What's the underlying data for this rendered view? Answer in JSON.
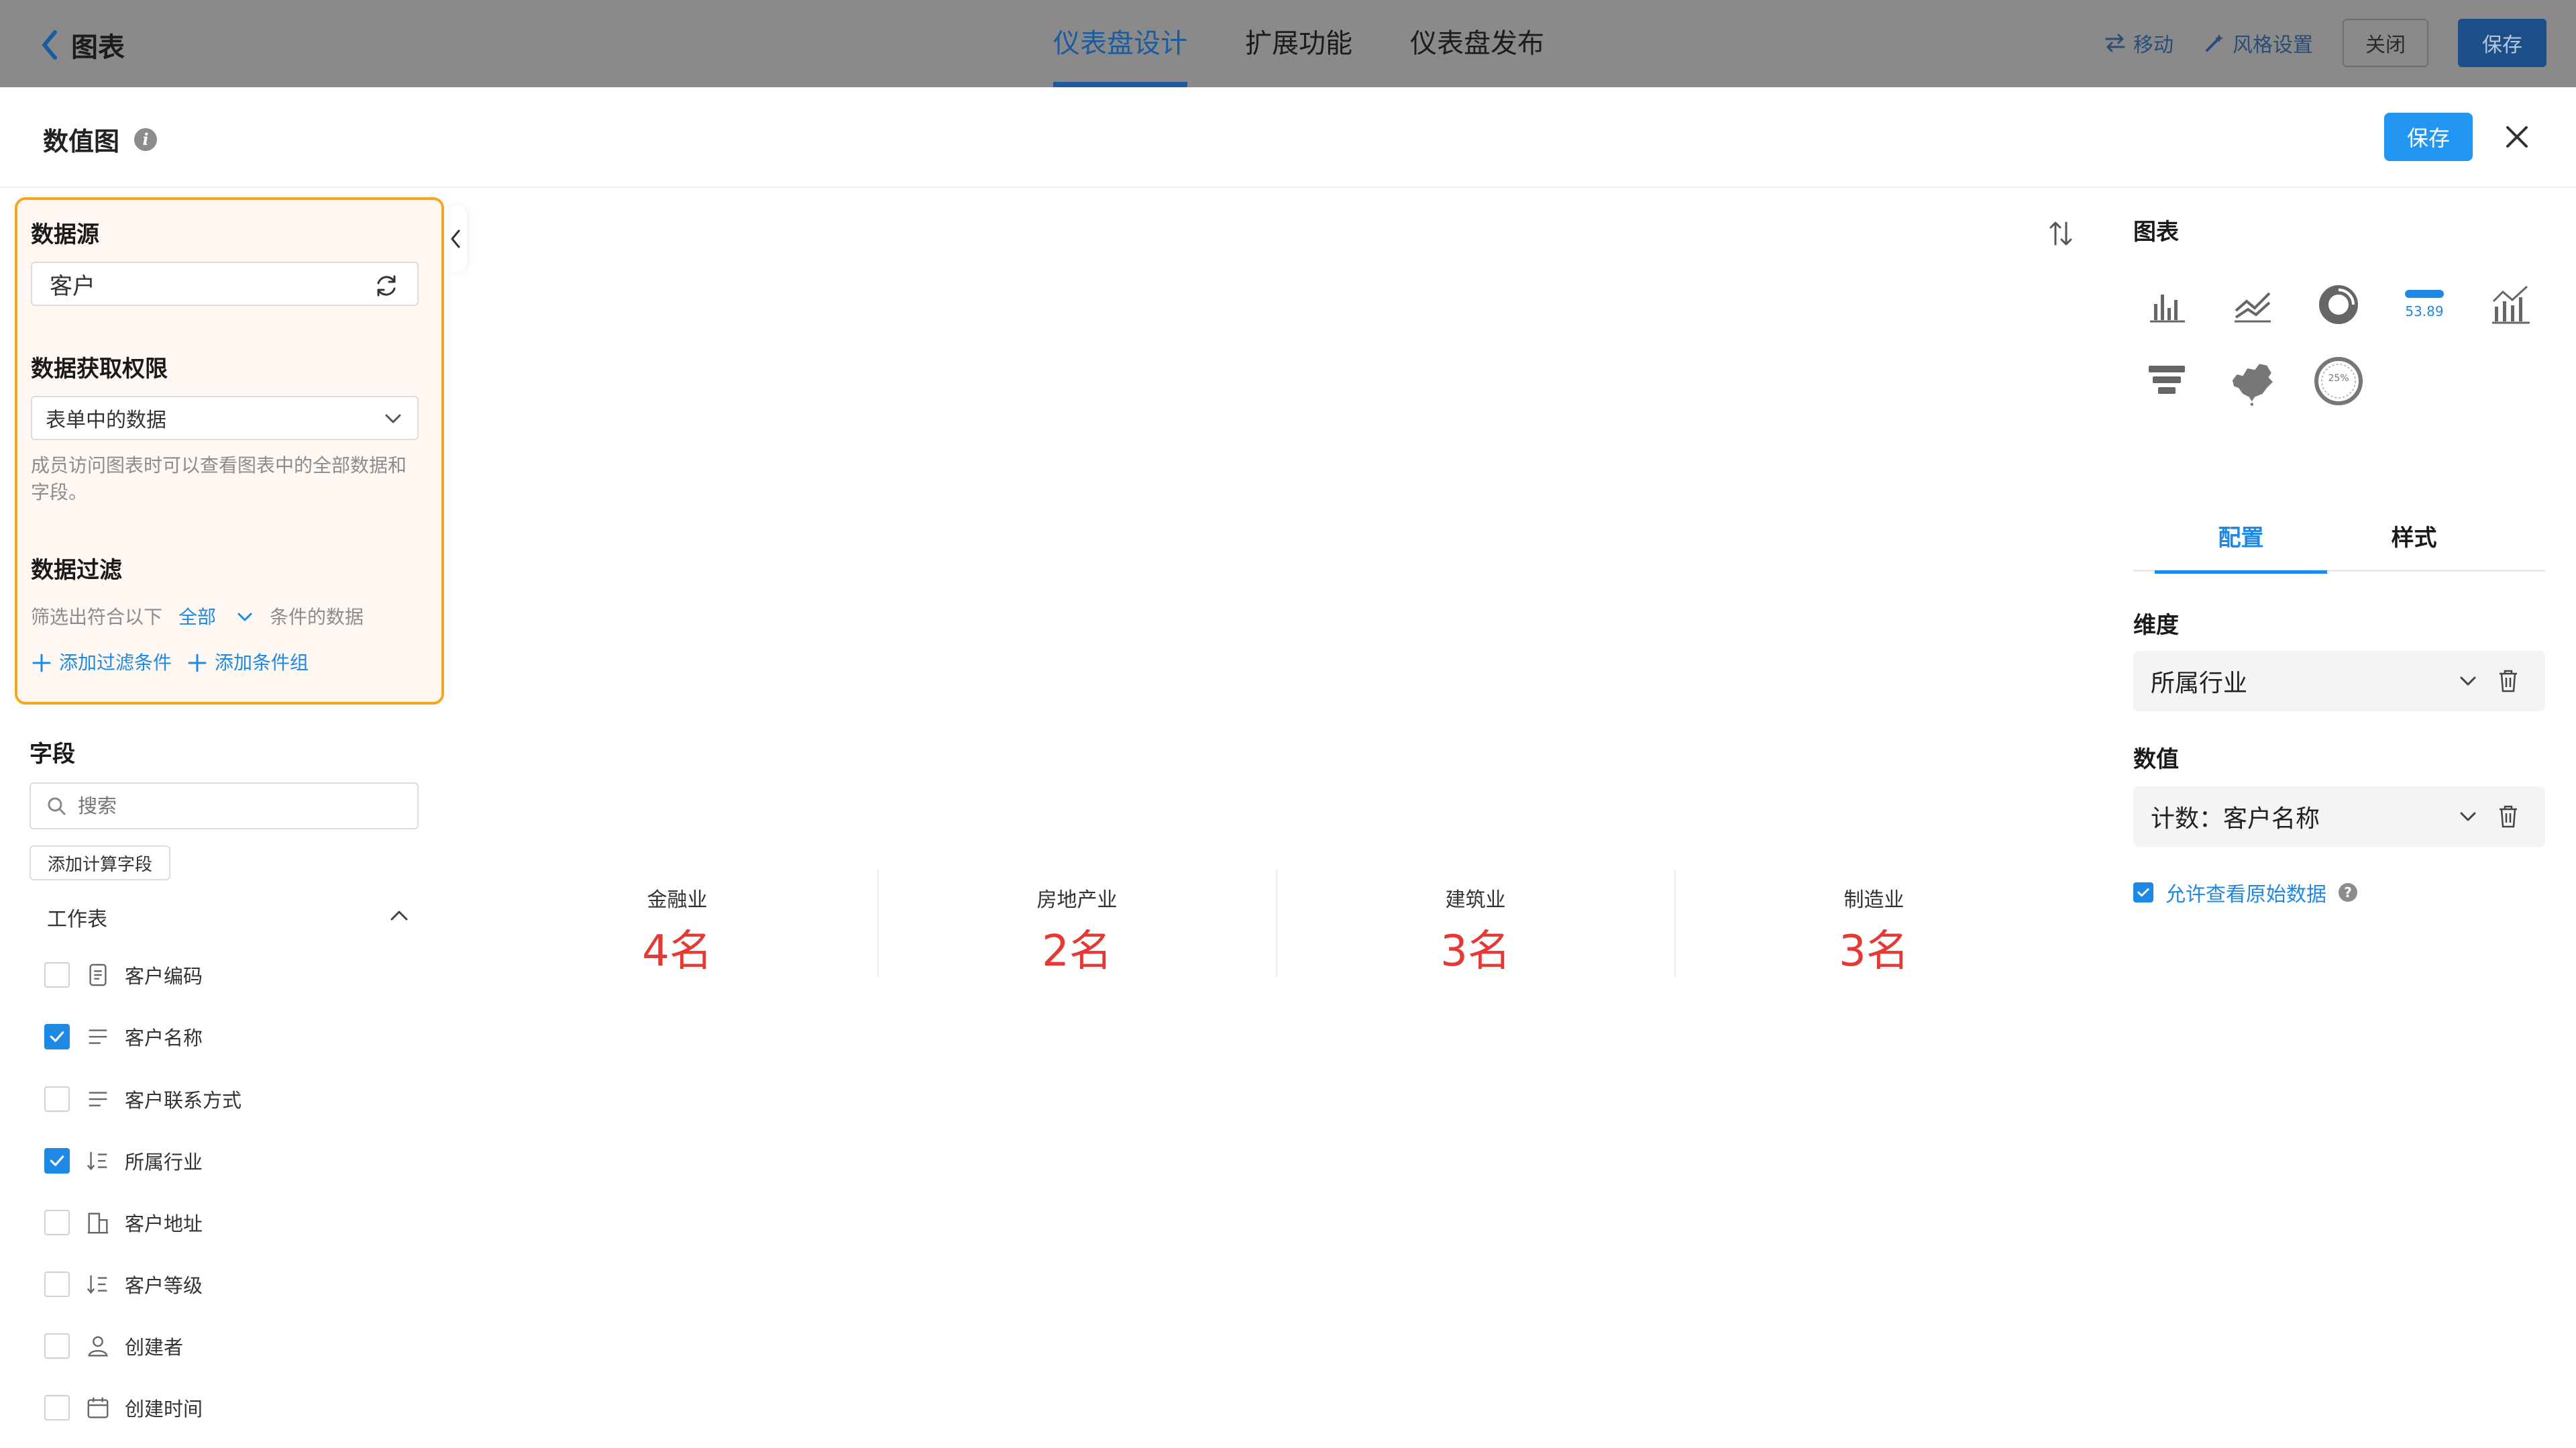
{
  "topbar": {
    "back_label": "图表",
    "tabs": [
      "仪表盘设计",
      "扩展功能",
      "仪表盘发布"
    ],
    "move_label": "移动",
    "style_label": "风格设置",
    "close_label": "关闭",
    "save_label": "保存"
  },
  "panel": {
    "title": "数值图",
    "save_label": "保存"
  },
  "data_source": {
    "title": "数据源",
    "value": "客户",
    "permission_title": "数据获取权限",
    "permission_value": "表单中的数据",
    "permission_hint": "成员访问图表时可以查看图表中的全部数据和字段。",
    "filter_title": "数据过滤",
    "filter_prefix": "筛选出符合以下",
    "filter_mode": "全部",
    "filter_suffix": "条件的数据",
    "add_filter": "添加过滤条件",
    "add_group": "添加条件组"
  },
  "fields": {
    "title": "字段",
    "search_placeholder": "搜索",
    "add_calc": "添加计算字段",
    "group": "工作表",
    "items": [
      {
        "label": "客户编码",
        "checked": false,
        "icon": "text-field-icon"
      },
      {
        "label": "客户名称",
        "checked": true,
        "icon": "lines-icon"
      },
      {
        "label": "客户联系方式",
        "checked": false,
        "icon": "lines-icon"
      },
      {
        "label": "所属行业",
        "checked": true,
        "icon": "sort-list-icon"
      },
      {
        "label": "客户地址",
        "checked": false,
        "icon": "building-icon"
      },
      {
        "label": "客户等级",
        "checked": false,
        "icon": "sort-list-icon"
      },
      {
        "label": "创建者",
        "checked": false,
        "icon": "user-icon"
      },
      {
        "label": "创建时间",
        "checked": false,
        "icon": "calendar-icon"
      }
    ]
  },
  "chart_data": {
    "type": "table",
    "categories": [
      "金融业",
      "房地产业",
      "建筑业",
      "制造业"
    ],
    "values": [
      "4名",
      "2名",
      "3名",
      "3名"
    ]
  },
  "config": {
    "chart_title": "图表",
    "number_icon_label": "53.89",
    "gauge_icon_label": "25%",
    "tabs": [
      "配置",
      "样式"
    ],
    "dimension_title": "维度",
    "dimension_value": "所属行业",
    "value_title": "数值",
    "value_value": "计数：客户名称",
    "allow_raw": "允许查看原始数据"
  },
  "colors": {
    "accent": "#1e88e5",
    "value_red": "#e53935",
    "highlight_border": "#f5a623"
  }
}
